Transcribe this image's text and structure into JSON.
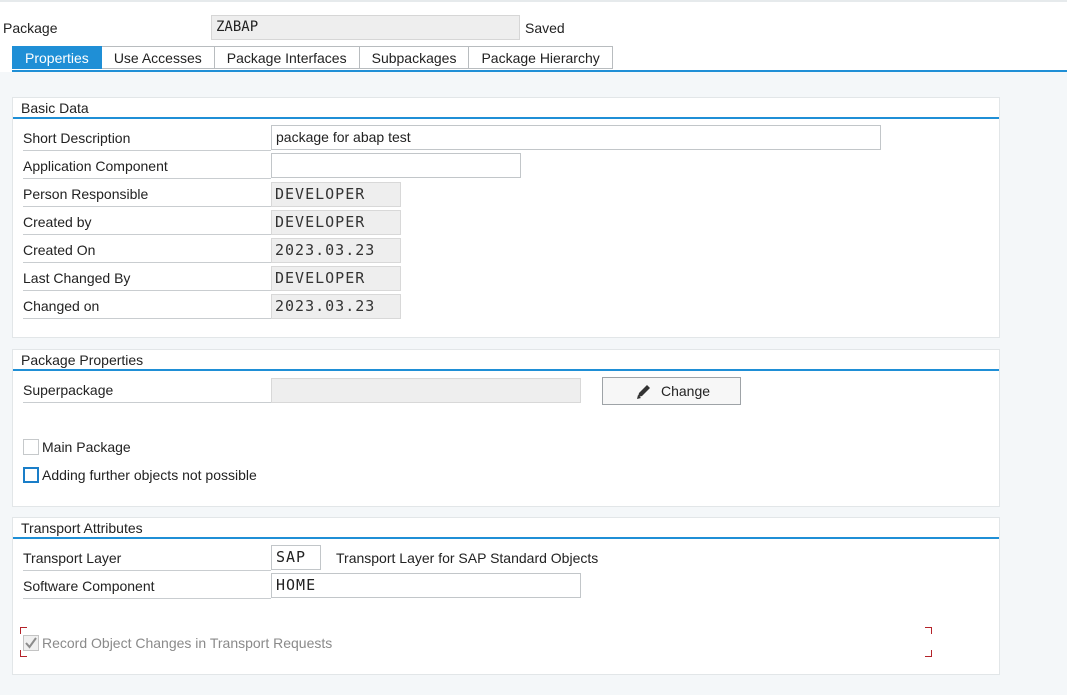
{
  "header": {
    "package_label": "Package",
    "package_value": "ZABAP",
    "status": "Saved"
  },
  "tabs": [
    {
      "label": "Properties",
      "active": true
    },
    {
      "label": "Use Accesses",
      "active": false
    },
    {
      "label": "Package Interfaces",
      "active": false
    },
    {
      "label": "Subpackages",
      "active": false
    },
    {
      "label": "Package Hierarchy",
      "active": false
    }
  ],
  "basic_data": {
    "title": "Basic Data",
    "short_description_label": "Short Description",
    "short_description_value": "package for abap test",
    "application_component_label": "Application Component",
    "application_component_value": "",
    "person_responsible_label": "Person Responsible",
    "person_responsible_value": "DEVELOPER",
    "created_by_label": "Created by",
    "created_by_value": "DEVELOPER",
    "created_on_label": "Created On",
    "created_on_value": "2023.03.23",
    "last_changed_by_label": "Last Changed By",
    "last_changed_by_value": "DEVELOPER",
    "changed_on_label": "Changed on",
    "changed_on_value": "2023.03.23"
  },
  "package_properties": {
    "title": "Package Properties",
    "superpackage_label": "Superpackage",
    "superpackage_value": "",
    "change_button": "Change",
    "main_package_label": "Main Package",
    "main_package_checked": false,
    "no_further_objects_label": "Adding further objects not possible",
    "no_further_objects_checked": false
  },
  "transport_attributes": {
    "title": "Transport Attributes",
    "transport_layer_label": "Transport Layer",
    "transport_layer_value": "SAP",
    "transport_layer_desc": "Transport Layer for SAP Standard Objects",
    "software_component_label": "Software Component",
    "software_component_value": "HOME",
    "record_changes_label": "Record Object Changes in Transport Requests",
    "record_changes_checked": true
  },
  "colors": {
    "accent": "#1f8fd6",
    "background": "#f4f7f9",
    "readonly_field": "#eeeeee"
  }
}
